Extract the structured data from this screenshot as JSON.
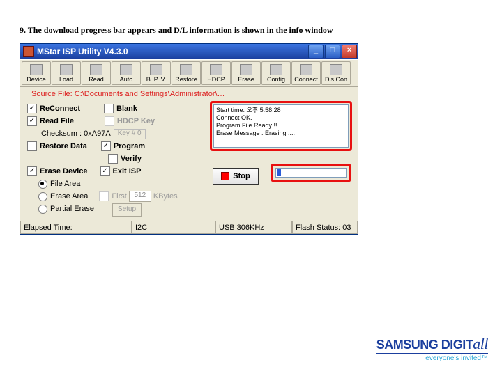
{
  "caption": "9. The download progress bar appears and D/L information is shown in the info window",
  "win": {
    "title": "MStar ISP Utility V4.3.0",
    "min": "_",
    "max": "□",
    "close": "×"
  },
  "toolbar": {
    "items": [
      {
        "label": "Device"
      },
      {
        "label": "Load"
      },
      {
        "label": "Read"
      },
      {
        "label": "Auto"
      },
      {
        "label": "B. P. V."
      },
      {
        "label": "Restore"
      },
      {
        "label": "HDCP"
      },
      {
        "label": "Erase"
      },
      {
        "label": "Config"
      },
      {
        "label": "Connect"
      },
      {
        "label": "Dis Con"
      }
    ]
  },
  "src": "Source File: C:\\Documents and Settings\\Administrator\\…",
  "opts": {
    "reconnect": "ReConnect",
    "blank": "Blank",
    "readfile": "Read File",
    "hdcpkey": "HDCP Key",
    "checksum_label": "Checksum : 0xA97A",
    "keybox": "Key # 0",
    "restoredata": "Restore Data",
    "program": "Program",
    "verify": "Verify",
    "erasedev": "Erase Device",
    "exitisp": "Exit ISP",
    "filearea": "File Area",
    "erasearea": "Erase Area",
    "partial": "Partial Erase",
    "first": "First",
    "firstval": "512",
    "kbytes": "KBytes",
    "setup": "Setup"
  },
  "info": "Start time: 오후 5:58:28\nConnect OK.\nProgram File Ready !!\nErase Message : Erasing ....",
  "stop": "Stop",
  "status": {
    "elapsed": "Elapsed Time:",
    "bus": "I2C",
    "usb": "USB   306KHz",
    "flash": "Flash Status: 03"
  },
  "logo": {
    "brand_a": "SAMSUNG DIGIT",
    "brand_b": "all",
    "tag": "everyone's invited™"
  }
}
